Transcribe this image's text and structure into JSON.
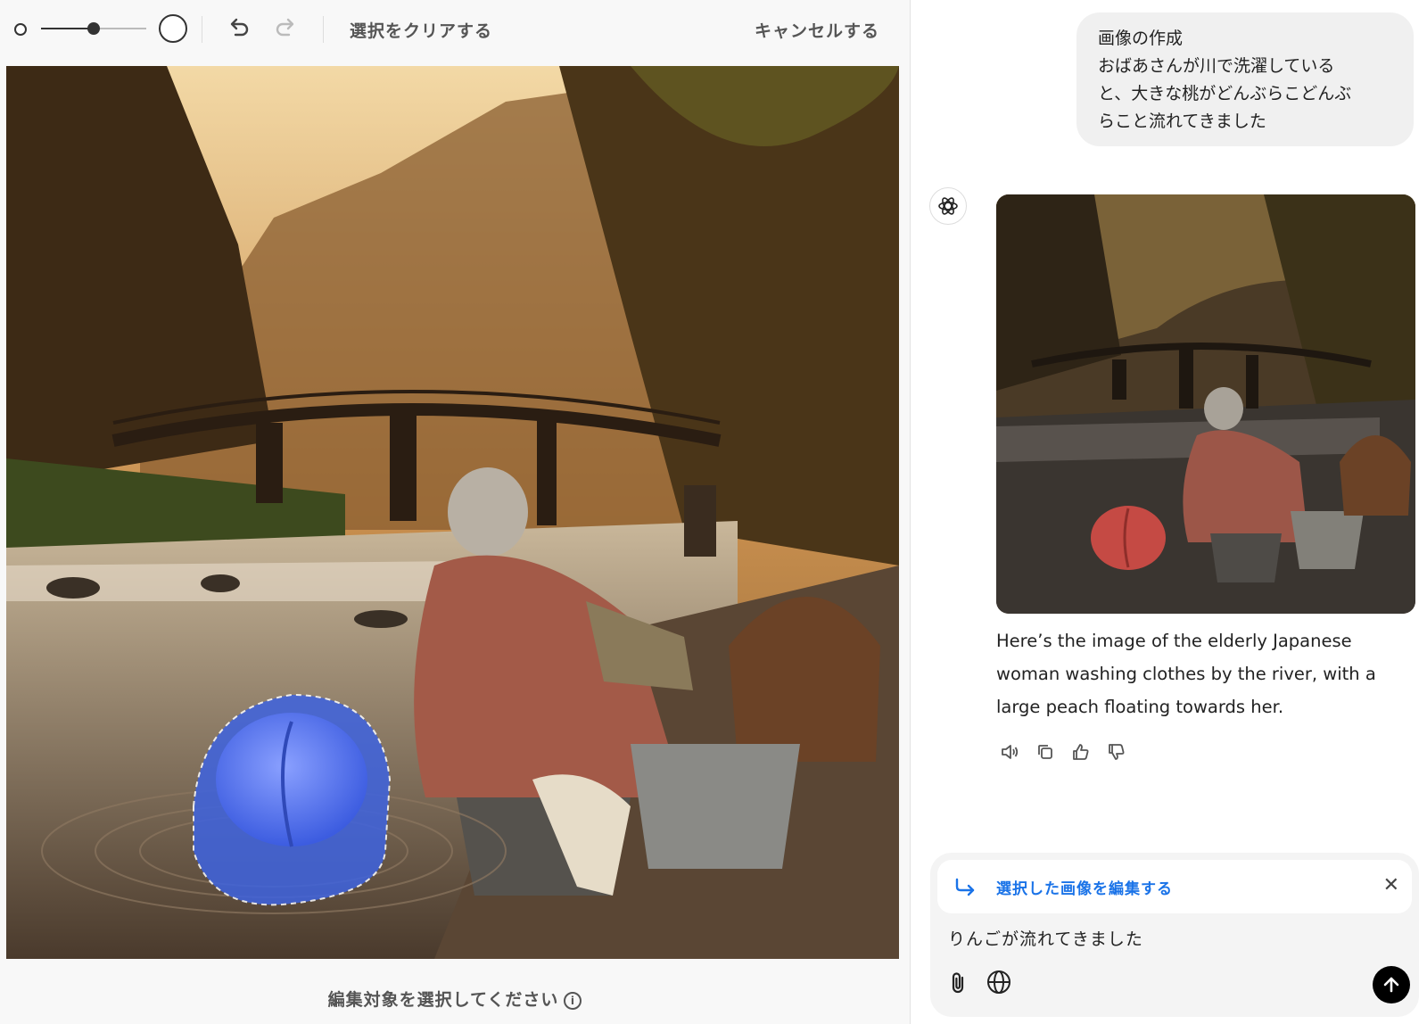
{
  "toolbar": {
    "brush_size": 0.5,
    "clear_selection_label": "選択をクリアする",
    "cancel_label": "キャンセルする"
  },
  "footer": {
    "hint": "編集対象を選択してください"
  },
  "chat": {
    "user_message": {
      "line1": "画像の作成",
      "line2": "おばあさんが川で洗濯している",
      "line3": "と、大きな桃がどんぶらこどんぶ",
      "line4": "らこと流れてきました"
    },
    "assistant_text": "Here’s the image of the elderly Japanese woman washing clothes by the river, with a large peach floating towards her.",
    "actions": [
      "speaker-icon",
      "copy-icon",
      "thumbs-up-icon",
      "thumbs-down-icon"
    ]
  },
  "composer": {
    "edit_chip_label": "選択した画像を編集する",
    "input_value": "りんごが流れてきました"
  },
  "colors": {
    "accent": "#1a73e8",
    "mask": "#3e63e0"
  }
}
